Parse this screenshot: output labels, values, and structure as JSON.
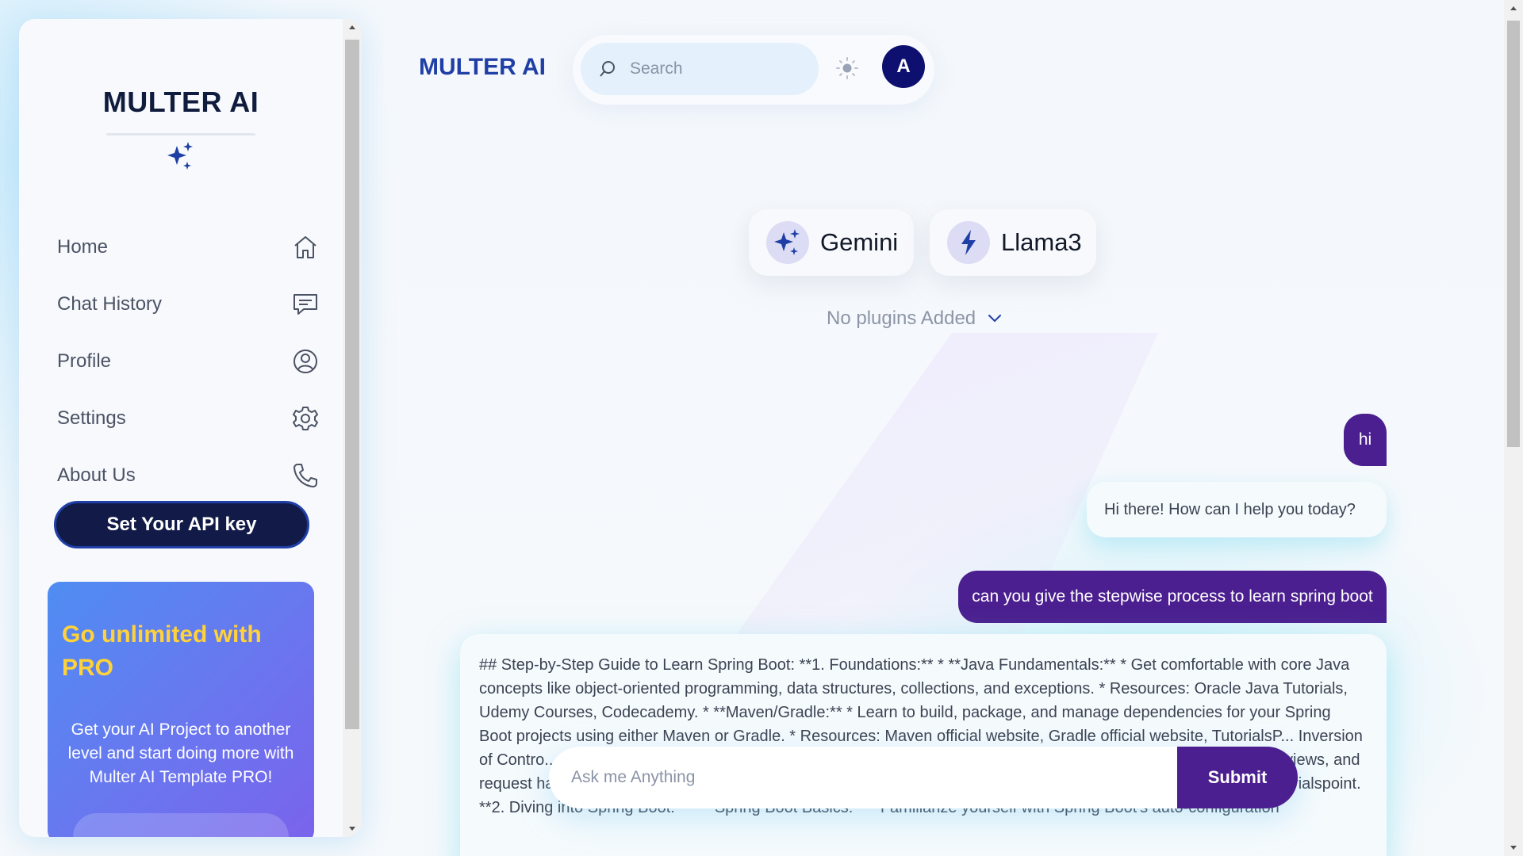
{
  "app": {
    "brand": "MULTER AI"
  },
  "sidebar": {
    "brand": "MULTER AI",
    "items": [
      {
        "label": "Home",
        "icon": "home-icon"
      },
      {
        "label": "Chat History",
        "icon": "chat-icon"
      },
      {
        "label": "Profile",
        "icon": "user-circle-icon"
      },
      {
        "label": "Settings",
        "icon": "gear-icon"
      },
      {
        "label": "About Us",
        "icon": "phone-icon"
      }
    ],
    "api_button": "Set Your API key",
    "pro": {
      "title": "Go unlimited with PRO",
      "text": "Get your AI Project to another level and start doing more with Multer AI Template PRO!"
    }
  },
  "header": {
    "brand": "MULTER AI",
    "search_placeholder": "Search",
    "avatar_letter": "A"
  },
  "models": [
    {
      "label": "Gemini",
      "icon": "sparkle-icon"
    },
    {
      "label": "Llama3",
      "icon": "lightning-icon"
    }
  ],
  "plugins": {
    "label": "No plugins Added"
  },
  "chat": {
    "messages": [
      {
        "role": "user",
        "text": "hi"
      },
      {
        "role": "assistant",
        "text": "Hi there! How can I help you today?"
      },
      {
        "role": "user",
        "text": "can you give the stepwise process to learn spring boot"
      },
      {
        "role": "assistant",
        "text": "## Step-by-Step Guide to Learn Spring Boot: **1. Foundations:** * **Java Fundamentals:** * Get comfortable with core Java concepts like object-oriented programming, data structures, collections, and exceptions. * Resources: Oracle Java Tutorials, Udemy Courses, Codecademy. * **Maven/Gradle:** * Learn to build, package, and manage dependencies for your Spring Boot projects using either Maven or Gradle. * Resources: Maven official website, Gradle official website, TutorialsP... Inversion of Contro... ...ring MVC:** * Learn how to create web applications using Spring MVC, including controllers, models, views, and request handling. * Resources: Spring MVC documentation, Spring MVC Tutorial by Javainuse, Spring MVC by Tutorialspoint. **2. Diving into Spring Boot:** * **Spring Boot Basics:** * Familiarize yourself with Spring Boot's auto-configuration"
      }
    ]
  },
  "composer": {
    "placeholder": "Ask me Anything",
    "submit_label": "Submit"
  },
  "colors": {
    "accent": "#4b1f8f",
    "brand_blue": "#1f3fa6",
    "api_button_bg": "#121b48",
    "avatar_bg": "#0e1070",
    "pro_title": "#ffd23a"
  }
}
